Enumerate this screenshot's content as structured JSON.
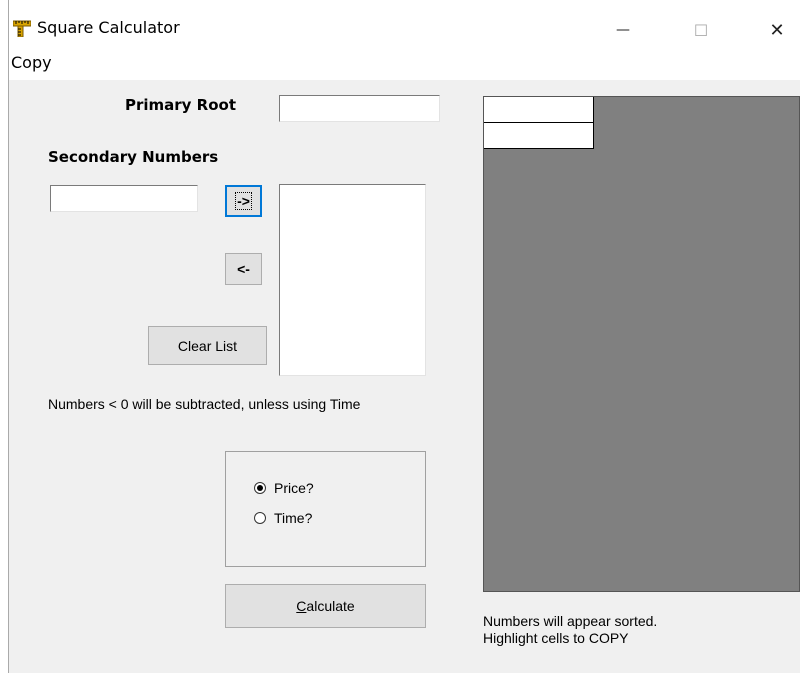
{
  "window": {
    "title": "Square Calculator",
    "app_icon": "ruler-calculator-icon",
    "controls": {
      "minimize": "—",
      "maximize": "☐",
      "close": "✕"
    }
  },
  "menu": {
    "items": [
      {
        "label": "Copy"
      }
    ]
  },
  "form": {
    "primary_root_label": "Primary Root",
    "primary_root_value": "",
    "secondary_label": "Secondary Numbers",
    "secondary_input_value": "",
    "add_button_label": "->",
    "remove_button_label": "<-",
    "clear_button_label": "Clear List",
    "note_negative": "Numbers <  0 will be subtracted, unless using Time",
    "options": {
      "price_label": "Price?",
      "time_label": "Time?",
      "selected": "Price?"
    },
    "calculate_label_prefix": "C",
    "calculate_label_rest": "alculate"
  },
  "results": {
    "note_line1": "Numbers will appear sorted.",
    "note_line2": "Highlight cells to COPY",
    "cells": [
      "",
      ""
    ]
  },
  "colors": {
    "window_bg": "#f0f0f0",
    "grid_bg": "#808080",
    "focus_border": "#0078d7"
  }
}
